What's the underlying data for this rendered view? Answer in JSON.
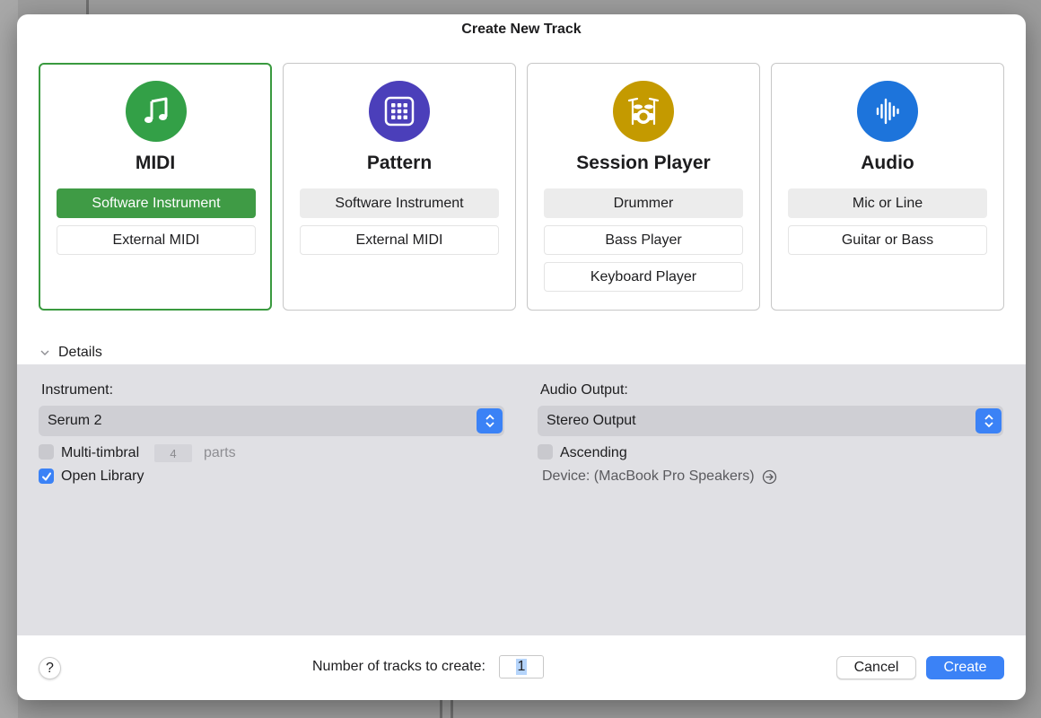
{
  "dialog": {
    "title": "Create New Track"
  },
  "cards": [
    {
      "title": "MIDI",
      "icon": "music-note-icon",
      "color": "#33a047",
      "selected": true,
      "options": [
        {
          "label": "Software Instrument",
          "active": true
        },
        {
          "label": "External MIDI",
          "active": false
        }
      ]
    },
    {
      "title": "Pattern",
      "icon": "grid-pad-icon",
      "color": "#4b3fba",
      "selected": false,
      "options": [
        {
          "label": "Software Instrument",
          "active": false
        },
        {
          "label": "External MIDI",
          "active": false
        }
      ]
    },
    {
      "title": "Session Player",
      "icon": "drum-kit-icon",
      "color": "#c49a00",
      "selected": false,
      "options": [
        {
          "label": "Drummer",
          "active": false
        },
        {
          "label": "Bass Player",
          "active": false
        },
        {
          "label": "Keyboard Player",
          "active": false
        }
      ]
    },
    {
      "title": "Audio",
      "icon": "waveform-icon",
      "color": "#1d74db",
      "selected": false,
      "options": [
        {
          "label": "Mic or Line",
          "active": false
        },
        {
          "label": "Guitar or Bass",
          "active": false
        }
      ]
    }
  ],
  "details": {
    "toggle_label": "Details",
    "instrument_label": "Instrument:",
    "instrument_value": "Serum 2",
    "multitimbral_label": "Multi-timbral",
    "multitimbral_checked": false,
    "parts_value": "4",
    "parts_label": "parts",
    "open_library_label": "Open Library",
    "open_library_checked": true,
    "audio_output_label": "Audio Output:",
    "audio_output_value": "Stereo Output",
    "ascending_label": "Ascending",
    "ascending_checked": false,
    "device_label": "Device: (MacBook Pro Speakers)"
  },
  "footer": {
    "help_label": "?",
    "count_label": "Number of tracks to create:",
    "count_value": "1",
    "cancel_label": "Cancel",
    "create_label": "Create"
  },
  "colors": {
    "accent_blue": "#3b82f6",
    "selected_green": "#3f9b45"
  }
}
